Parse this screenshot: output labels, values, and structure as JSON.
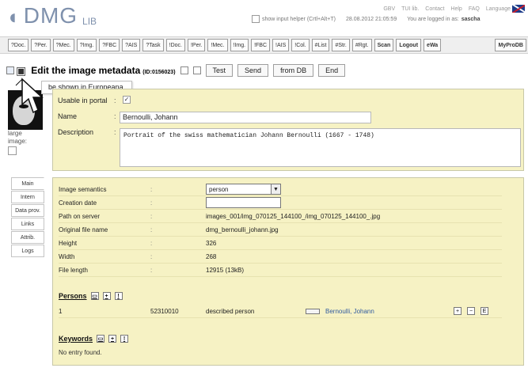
{
  "header": {
    "logo_dmg": "DMG",
    "logo_lib": "LIB",
    "top_links": [
      "GBV",
      "TUI lib.",
      "Contact",
      "Help",
      "FAQ",
      "Language"
    ],
    "helper_label": "show input helper (Crtl+Alt+T)",
    "datetime": "28.08.2012 21:05:59",
    "logged_in_label": "You are logged in as:",
    "username": "sascha"
  },
  "nav": {
    "items": [
      "?Doc.",
      "?Per.",
      "?Mec.",
      "?Img.",
      "?FBC",
      "?AIS",
      "?Task",
      "!Doc.",
      "!Per.",
      "!Mec.",
      "!Img.",
      "!FBC",
      "!AIS",
      "!Col.",
      "#List",
      "#Str.",
      "#Rgt.",
      "Scan",
      "Logout",
      "eWa"
    ],
    "right_item": "MyProDB"
  },
  "title": {
    "main": "Edit the image metadata",
    "id": "(ID:0156023)",
    "buttons": [
      "Test",
      "Send",
      "from DB",
      "End"
    ]
  },
  "tooltip": "be shown in Europeana.",
  "sidebar_image": {
    "large_label": "large",
    "image_label": "image:"
  },
  "top_form": {
    "usable_label": "Usable in portal",
    "usable_checked": "✓",
    "name_label": "Name",
    "name_value": "Bernoulli, Johann",
    "description_label": "Description",
    "description_value": "Portrait of the swiss mathematician Johann Bernoulli (1667 - 1748)"
  },
  "tabs": [
    "Main",
    "Intern",
    "Data prov.",
    "Links",
    "Attrib.",
    "Logs"
  ],
  "details": {
    "image_semantics_label": "Image semantics",
    "image_semantics_value": "person",
    "creation_date_label": "Creation date",
    "path_label": "Path on server",
    "path_value": "images_001/img_070125_144100_/img_070125_144100_.jpg",
    "filename_label": "Original file name",
    "filename_value": "dmg_bernoulli_johann.jpg",
    "height_label": "Height",
    "height_value": "326",
    "width_label": "Width",
    "width_value": "268",
    "filelength_label": "File length",
    "filelength_value": "12915 (13kB)"
  },
  "persons": {
    "title": "Persons",
    "row": {
      "index": "1",
      "id": "52310010",
      "role": "described person",
      "name": "Bernoulli, Johann"
    }
  },
  "keywords": {
    "title": "Keywords",
    "empty_text": "No entry found."
  },
  "colors": {
    "panel": "#f6f2c4",
    "link": "#315b9f"
  }
}
